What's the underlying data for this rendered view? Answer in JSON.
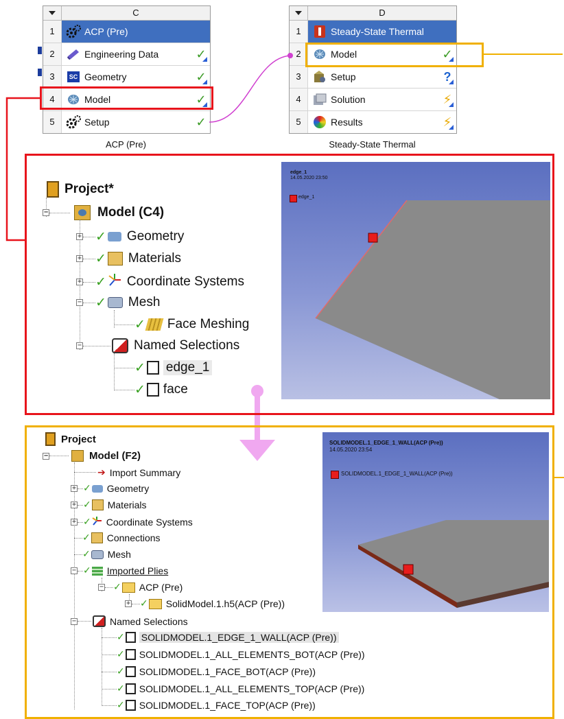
{
  "system_c": {
    "column": "C",
    "caption": "ACP (Pre)",
    "rows": [
      {
        "num": "1",
        "label": "ACP (Pre)",
        "status": ""
      },
      {
        "num": "2",
        "label": "Engineering Data",
        "status": "✓"
      },
      {
        "num": "3",
        "label": "Geometry",
        "status": "✓"
      },
      {
        "num": "4",
        "label": "Model",
        "status": "✓"
      },
      {
        "num": "5",
        "label": "Setup",
        "status": "✓"
      }
    ],
    "geometry_badge": "SC"
  },
  "system_d": {
    "column": "D",
    "caption": "Steady-State Thermal",
    "rows": [
      {
        "num": "1",
        "label": "Steady-State Thermal",
        "status": ""
      },
      {
        "num": "2",
        "label": "Model",
        "status": "✓"
      },
      {
        "num": "3",
        "label": "Setup",
        "status": "?"
      },
      {
        "num": "4",
        "label": "Solution",
        "status": "⚡"
      },
      {
        "num": "5",
        "label": "Results",
        "status": "⚡"
      }
    ]
  },
  "tree_upper": {
    "root": "Project*",
    "model": "Model (C4)",
    "items": [
      "Geometry",
      "Materials",
      "Coordinate Systems",
      "Mesh",
      "Face Meshing",
      "Named Selections",
      "edge_1",
      "face"
    ]
  },
  "viewport_upper": {
    "title": "edge_1",
    "date": "14.05.2020 23:50",
    "legend": "edge_1"
  },
  "tree_lower": {
    "root": "Project",
    "model": "Model (F2)",
    "items": [
      "Import Summary",
      "Geometry",
      "Materials",
      "Coordinate Systems",
      "Connections",
      "Mesh",
      "Imported Plies",
      "ACP (Pre)",
      "SolidModel.1.h5(ACP (Pre))",
      "Named Selections",
      "SOLIDMODEL.1_EDGE_1_WALL(ACP (Pre))",
      "SOLIDMODEL.1_ALL_ELEMENTS_BOT(ACP (Pre))",
      "SOLIDMODEL.1_FACE_BOT(ACP (Pre))",
      "SOLIDMODEL.1_ALL_ELEMENTS_TOP(ACP (Pre))",
      "SOLIDMODEL.1_FACE_TOP(ACP (Pre))"
    ]
  },
  "viewport_lower": {
    "title": "SOLIDMODEL.1_EDGE_1_WALL(ACP (Pre))",
    "date": "14.05.2020 23:54",
    "legend": "SOLIDMODEL.1_EDGE_1_WALL(ACP (Pre))"
  },
  "colors": {
    "highlight_red": "#e8141c",
    "highlight_orange": "#f0b000",
    "connector_magenta": "#d040d0",
    "flow_arrow": "#f0a8f0",
    "viewport_bg": "#6f80c4",
    "selection_marker": "#e81c1c"
  }
}
